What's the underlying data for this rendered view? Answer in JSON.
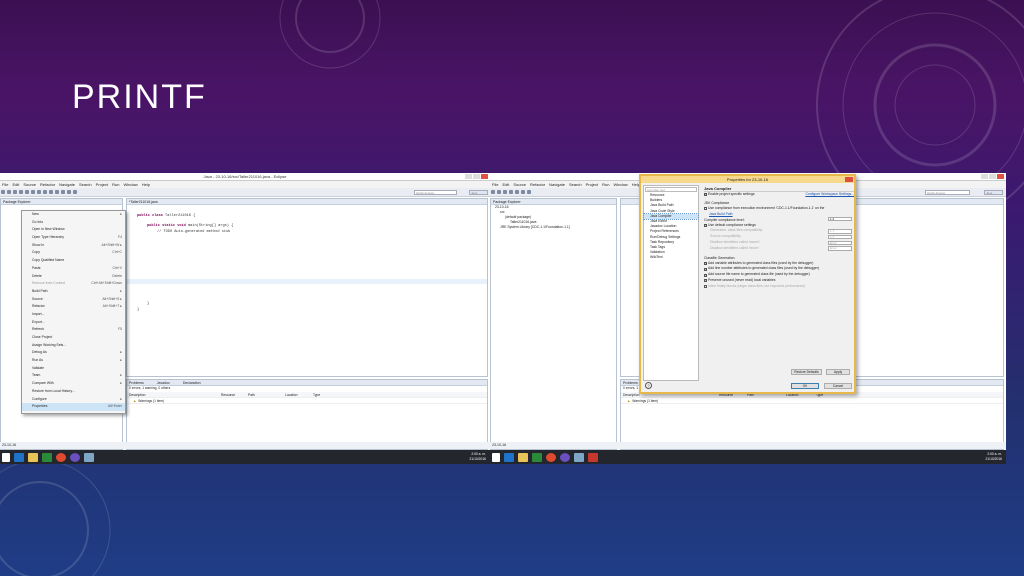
{
  "slide": {
    "title": "PRINTF"
  },
  "shot1": {
    "window_title": "Java - 23-10-16/src/Taller211016.java - Eclipse",
    "menu": [
      "File",
      "Edit",
      "Source",
      "Refactor",
      "Navigate",
      "Search",
      "Project",
      "Run",
      "Window",
      "Help"
    ],
    "quick_access": "Quick Access",
    "perspective": "Java",
    "package_explorer_tab": "Package Explorer",
    "editor_tab": "*Taller211016.java",
    "code": {
      "line1_kw": "public class",
      "line1_rest": " Taller211016 {",
      "line2_kw": "public static void",
      "line2_rest": " main(String[] args) {",
      "line3": "// TODO Auto-generated method stub",
      "line4": "}",
      "line5": "}"
    },
    "context_menu": [
      {
        "label": "New",
        "key": "▸"
      },
      {
        "label": "Go Into",
        "key": ""
      },
      {
        "label": "Open in New Window",
        "key": ""
      },
      {
        "label": "Open Type Hierarchy",
        "key": "F4"
      },
      {
        "label": "Show In",
        "key": "Alt+Shift+W ▸"
      },
      {
        "label": "Copy",
        "key": "Ctrl+C"
      },
      {
        "label": "Copy Qualified Name",
        "key": ""
      },
      {
        "label": "Paste",
        "key": "Ctrl+V"
      },
      {
        "label": "Delete",
        "key": "Delete"
      },
      {
        "label": "Remove from Context",
        "key": "Ctrl+Alt+Shift+Down"
      },
      {
        "label": "Build Path",
        "key": "▸"
      },
      {
        "label": "Source",
        "key": "Alt+Shift+S ▸"
      },
      {
        "label": "Refactor",
        "key": "Alt+Shift+T ▸"
      },
      {
        "label": "Import...",
        "key": ""
      },
      {
        "label": "Export...",
        "key": ""
      },
      {
        "label": "Refresh",
        "key": "F5"
      },
      {
        "label": "Close Project",
        "key": ""
      },
      {
        "label": "Assign Working Sets...",
        "key": ""
      },
      {
        "label": "Debug As",
        "key": "▸"
      },
      {
        "label": "Run As",
        "key": "▸"
      },
      {
        "label": "Validate",
        "key": ""
      },
      {
        "label": "Team",
        "key": "▸"
      },
      {
        "label": "Compare With",
        "key": "▸"
      },
      {
        "label": "Restore from Local History...",
        "key": ""
      },
      {
        "label": "Configure",
        "key": "▸"
      },
      {
        "label": "Properties",
        "key": "Alt+Enter"
      }
    ],
    "bottom_tabs": [
      "Problems",
      "Javadoc",
      "Declaration"
    ],
    "problems_summary": "0 errors, 1 warning, 0 others",
    "columns": [
      "Description",
      "Resource",
      "Path",
      "Location",
      "Type"
    ],
    "row1": "Warnings (1 item)",
    "status": "23-10-16",
    "tray_time": "2:00 a. m.",
    "tray_date": "21/10/2016"
  },
  "shot2": {
    "menu": [
      "File",
      "Edit",
      "Source",
      "Refactor",
      "Navigate",
      "Search",
      "Project",
      "Run",
      "Window",
      "Help"
    ],
    "quick_access": "Quick Access",
    "perspective": "Java",
    "package_explorer_tab": "Package Explorer",
    "tree": [
      "23-10-16",
      "src",
      "(default package)",
      "Taller211016.java",
      "JRE System Library [CDC-1.1/Foundation-1.1]"
    ],
    "dialog": {
      "title": "Properties for 23-10-16",
      "filter": "type filter text",
      "nav": [
        "Resource",
        "Builders",
        "Java Build Path",
        "Java Code Style",
        "Java Compiler",
        "Java Editor",
        "Javadoc Location",
        "Project References",
        "Run/Debug Settings",
        "Task Repository",
        "Task Tags",
        "Validation",
        "WikiText"
      ],
      "page_title": "Java Compiler",
      "enable_specific": "Enable project specific settings",
      "configure_ws": "Configure Workspace Settings...",
      "jdk_compliance": "JDK Compliance",
      "use_compliance": "Use compliance from execution environment 'CDC-1.1/Foundation-1.1' on the",
      "build_path_link": "Java Build Path",
      "compliance_level": "Compiler compliance level:",
      "compliance_value": "1.2",
      "use_default": "Use default compliance settings",
      "gen_class": "Generated .class files compatibility:",
      "gen_class_val": "1.7",
      "source_compat": "Source compatibility:",
      "source_compat_val": "1.7",
      "disallow_assert": "Disallow identifiers called 'assert':",
      "disallow_assert_val": "Error",
      "disallow_enum": "Disallow identifiers called 'enum':",
      "disallow_enum_val": "Error",
      "classfile_gen": "Classfile Generation",
      "opt1": "Add variable attributes to generated class files (used by the debugger)",
      "opt2": "Add line number attributes to generated class files (used by the debugger)",
      "opt3": "Add source file name to generated class file (used by the debugger)",
      "opt4": "Preserve unused (never read) local variables",
      "opt5": "Inline finally blocks (larger class files, but improved performance)",
      "restore_defaults": "Restore Defaults",
      "apply": "Apply",
      "ok": "OK",
      "cancel": "Cancel",
      "help": "?"
    },
    "bottom_tab": "Problems",
    "problems_summary": "0 errors, 1 warning, 0 others",
    "columns": [
      "Description",
      "Resource",
      "Path",
      "Location",
      "Type"
    ],
    "row1": "Warnings (1 item)",
    "status": "23-10-16",
    "tray_time": "2:00 a. m.",
    "tray_date": "21/10/2016"
  }
}
